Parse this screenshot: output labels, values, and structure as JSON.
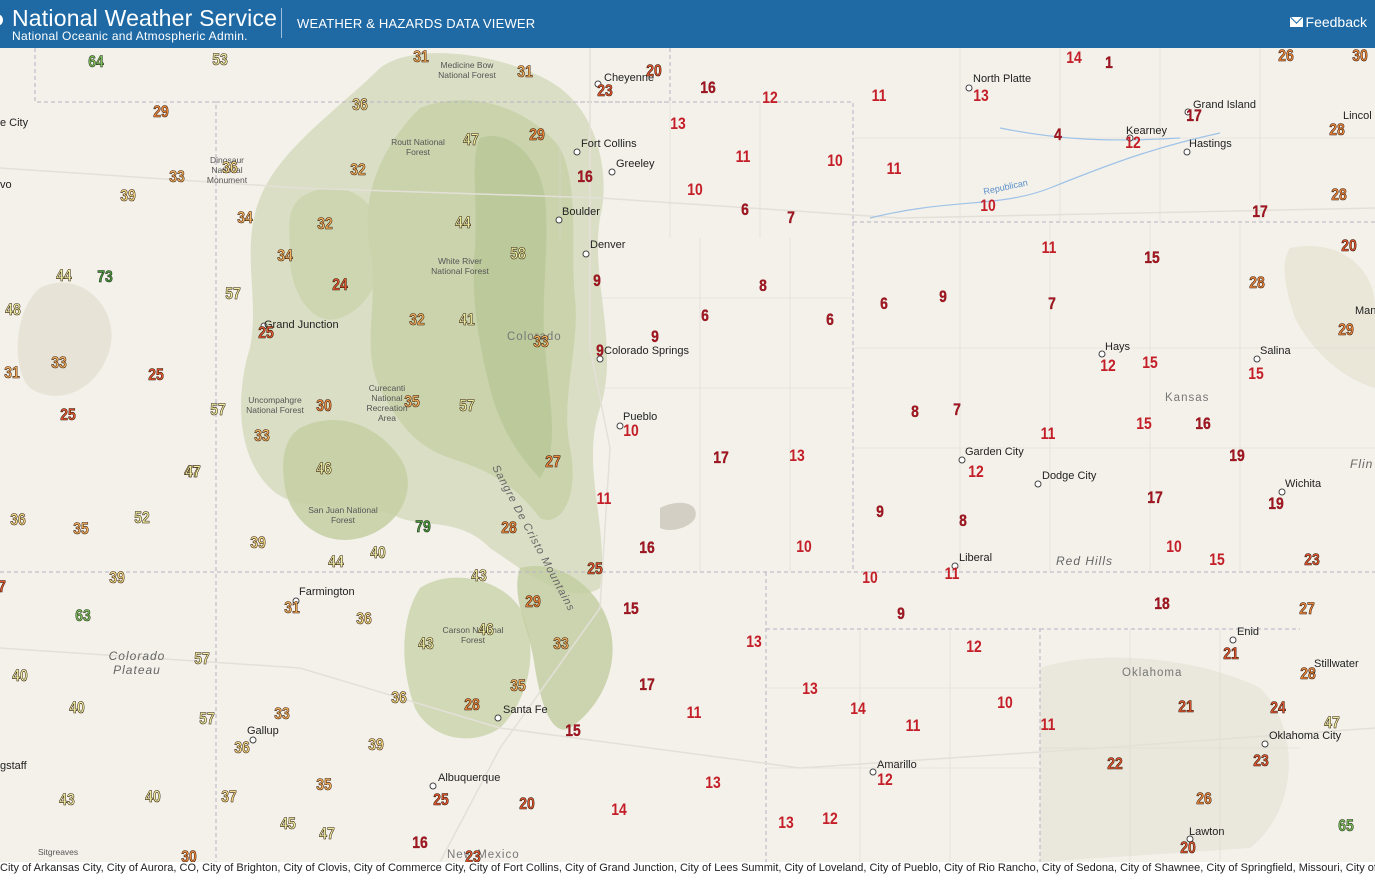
{
  "header": {
    "title": "National Weather Service",
    "subtitle": "National Oceanic and Atmospheric Admin.",
    "viewer_title": "WEATHER & HAZARDS DATA VIEWER",
    "feedback_label": "Feedback"
  },
  "map_labels": {
    "cities": [
      "Cheyenne",
      "North Platte",
      "Grand Island",
      "Kearney",
      "Hastings",
      "Fort Collins",
      "Greeley",
      "Boulder",
      "Denver",
      "Colorado Springs",
      "Pueblo",
      "Garden City",
      "Dodge City",
      "Hays",
      "Salina",
      "Wichita",
      "Liberal",
      "Grand Junction",
      "Farmington",
      "Santa Fe",
      "Gallup",
      "Albuquerque",
      "Amarillo",
      "Enid",
      "Stillwater",
      "Oklahoma City",
      "Lawton",
      "Man",
      "Lincol"
    ],
    "edge_cities": [
      "e City",
      "vo",
      "gstaff"
    ],
    "regions": [
      "Colorado Plateau",
      "Red Hills",
      "Republican",
      "Sangre De Cristo Mountains",
      "Colorado",
      "Kansas",
      "Oklahoma",
      "New Mexico",
      "Flin"
    ],
    "forests": [
      "Medicine Bow National Forest",
      "Routt National Forest",
      "Dinosaur National Monument",
      "White River National Forest",
      "Uncompahgre National Forest",
      "Curecanti National Recreation Area",
      "San Juan National Forest",
      "Carson National Forest",
      "Sitgreaves"
    ]
  },
  "temperatures": [
    {
      "value": "64",
      "cls": "c-green"
    },
    {
      "value": "53",
      "cls": "c-lyellow"
    },
    {
      "value": "31",
      "cls": "c-lorange"
    },
    {
      "value": "31",
      "cls": "c-lorange"
    },
    {
      "value": "20",
      "cls": "c-ored"
    },
    {
      "value": "23",
      "cls": "c-ored"
    },
    {
      "value": "16",
      "cls": "c-dark"
    },
    {
      "value": "12",
      "cls": "c-red"
    },
    {
      "value": "11",
      "cls": "c-red"
    },
    {
      "value": "13",
      "cls": "c-red"
    },
    {
      "value": "14",
      "cls": "c-red"
    },
    {
      "value": "1",
      "cls": "c-dark"
    },
    {
      "value": "26",
      "cls": "c-orange"
    },
    {
      "value": "30",
      "cls": "c-orange"
    },
    {
      "value": "29",
      "cls": "c-orange"
    },
    {
      "value": "36",
      "cls": "c-yellow"
    },
    {
      "value": "47",
      "cls": "c-lyellow"
    },
    {
      "value": "29",
      "cls": "c-orange"
    },
    {
      "value": "13",
      "cls": "c-red"
    },
    {
      "value": "17",
      "cls": "c-dark"
    },
    {
      "value": "28",
      "cls": "c-orange"
    },
    {
      "value": "33",
      "cls": "c-lorange"
    },
    {
      "value": "36",
      "cls": "c-yellow"
    },
    {
      "value": "32",
      "cls": "c-lorange"
    },
    {
      "value": "16",
      "cls": "c-dark"
    },
    {
      "value": "11",
      "cls": "c-red"
    },
    {
      "value": "10",
      "cls": "c-red"
    },
    {
      "value": "11",
      "cls": "c-red"
    },
    {
      "value": "4",
      "cls": "c-dark"
    },
    {
      "value": "12",
      "cls": "c-red"
    },
    {
      "value": "39",
      "cls": "c-yellow"
    },
    {
      "value": "10",
      "cls": "c-red"
    },
    {
      "value": "10",
      "cls": "c-red"
    },
    {
      "value": "28",
      "cls": "c-orange"
    },
    {
      "value": "34",
      "cls": "c-lorange"
    },
    {
      "value": "32",
      "cls": "c-lorange"
    },
    {
      "value": "44",
      "cls": "c-lyellow"
    },
    {
      "value": "6",
      "cls": "c-dark"
    },
    {
      "value": "7",
      "cls": "c-dark"
    },
    {
      "value": "17",
      "cls": "c-dark"
    },
    {
      "value": "58",
      "cls": "c-lyellow"
    },
    {
      "value": "11",
      "cls": "c-red"
    },
    {
      "value": "15",
      "cls": "c-dark"
    },
    {
      "value": "20",
      "cls": "c-ored"
    },
    {
      "value": "44",
      "cls": "c-lyellow"
    },
    {
      "value": "73",
      "cls": "c-dgreen"
    },
    {
      "value": "34",
      "cls": "c-lorange"
    },
    {
      "value": "9",
      "cls": "c-dark"
    },
    {
      "value": "8",
      "cls": "c-dark"
    },
    {
      "value": "28",
      "cls": "c-orange"
    },
    {
      "value": "24",
      "cls": "c-ored"
    },
    {
      "value": "57",
      "cls": "c-lyellow"
    },
    {
      "value": "48",
      "cls": "c-lyellow"
    },
    {
      "value": "6",
      "cls": "c-dark"
    },
    {
      "value": "6",
      "cls": "c-dark"
    },
    {
      "value": "6",
      "cls": "c-dark"
    },
    {
      "value": "9",
      "cls": "c-dark"
    },
    {
      "value": "7",
      "cls": "c-dark"
    },
    {
      "value": "32",
      "cls": "c-lorange"
    },
    {
      "value": "41",
      "cls": "c-lyellow"
    },
    {
      "value": "25",
      "cls": "c-ored"
    },
    {
      "value": "9",
      "cls": "c-dark"
    },
    {
      "value": "29",
      "cls": "c-orange"
    },
    {
      "value": "33",
      "cls": "c-lorange"
    },
    {
      "value": "9",
      "cls": "c-dark"
    },
    {
      "value": "33",
      "cls": "c-lorange"
    },
    {
      "value": "12",
      "cls": "c-red"
    },
    {
      "value": "15",
      "cls": "c-red"
    },
    {
      "value": "15",
      "cls": "c-red"
    },
    {
      "value": "31",
      "cls": "c-lorange"
    },
    {
      "value": "25",
      "cls": "c-ored"
    },
    {
      "value": "25",
      "cls": "c-ored"
    },
    {
      "value": "57",
      "cls": "c-lyellow"
    },
    {
      "value": "30",
      "cls": "c-orange"
    },
    {
      "value": "35",
      "cls": "c-lorange"
    },
    {
      "value": "57",
      "cls": "c-lyellow"
    },
    {
      "value": "10",
      "cls": "c-red"
    },
    {
      "value": "8",
      "cls": "c-dark"
    },
    {
      "value": "7",
      "cls": "c-dark"
    },
    {
      "value": "15",
      "cls": "c-red"
    },
    {
      "value": "16",
      "cls": "c-dark"
    },
    {
      "value": "33",
      "cls": "c-lorange"
    },
    {
      "value": "11",
      "cls": "c-red"
    },
    {
      "value": "47",
      "cls": "c-lyellow"
    },
    {
      "value": "46",
      "cls": "c-lyellow"
    },
    {
      "value": "27",
      "cls": "c-orange"
    },
    {
      "value": "17",
      "cls": "c-dark"
    },
    {
      "value": "13",
      "cls": "c-red"
    },
    {
      "value": "12",
      "cls": "c-red"
    },
    {
      "value": "19",
      "cls": "c-dark"
    },
    {
      "value": "11",
      "cls": "c-red"
    },
    {
      "value": "17",
      "cls": "c-dark"
    },
    {
      "value": "19",
      "cls": "c-dark"
    },
    {
      "value": "36",
      "cls": "c-yellow"
    },
    {
      "value": "35",
      "cls": "c-lorange"
    },
    {
      "value": "52",
      "cls": "c-lyellow"
    },
    {
      "value": "79",
      "cls": "c-dgreen"
    },
    {
      "value": "28",
      "cls": "c-orange"
    },
    {
      "value": "9",
      "cls": "c-dark"
    },
    {
      "value": "8",
      "cls": "c-dark"
    },
    {
      "value": "39",
      "cls": "c-yellow"
    },
    {
      "value": "40",
      "cls": "c-lyellow"
    },
    {
      "value": "16",
      "cls": "c-dark"
    },
    {
      "value": "10",
      "cls": "c-red"
    },
    {
      "value": "10",
      "cls": "c-red"
    },
    {
      "value": "15",
      "cls": "c-red"
    },
    {
      "value": "44",
      "cls": "c-lyellow"
    },
    {
      "value": "25",
      "cls": "c-ored"
    },
    {
      "value": "23",
      "cls": "c-ored"
    },
    {
      "value": "7",
      "cls": "c-ored"
    },
    {
      "value": "39",
      "cls": "c-yellow"
    },
    {
      "value": "43",
      "cls": "c-lyellow"
    },
    {
      "value": "10",
      "cls": "c-red"
    },
    {
      "value": "11",
      "cls": "c-red"
    },
    {
      "value": "29",
      "cls": "c-orange"
    },
    {
      "value": "31",
      "cls": "c-lorange"
    },
    {
      "value": "15",
      "cls": "c-dark"
    },
    {
      "value": "18",
      "cls": "c-dark"
    },
    {
      "value": "27",
      "cls": "c-orange"
    },
    {
      "value": "63",
      "cls": "c-green"
    },
    {
      "value": "36",
      "cls": "c-yellow"
    },
    {
      "value": "9",
      "cls": "c-dark"
    },
    {
      "value": "46",
      "cls": "c-lyellow"
    },
    {
      "value": "43",
      "cls": "c-lyellow"
    },
    {
      "value": "33",
      "cls": "c-lorange"
    },
    {
      "value": "13",
      "cls": "c-red"
    },
    {
      "value": "12",
      "cls": "c-red"
    },
    {
      "value": "57",
      "cls": "c-lyellow"
    },
    {
      "value": "21",
      "cls": "c-ored"
    },
    {
      "value": "40",
      "cls": "c-lyellow"
    },
    {
      "value": "28",
      "cls": "c-orange"
    },
    {
      "value": "17",
      "cls": "c-dark"
    },
    {
      "value": "35",
      "cls": "c-lorange"
    },
    {
      "value": "13",
      "cls": "c-red"
    },
    {
      "value": "36",
      "cls": "c-yellow"
    },
    {
      "value": "40",
      "cls": "c-lyellow"
    },
    {
      "value": "28",
      "cls": "c-orange"
    },
    {
      "value": "11",
      "cls": "c-red"
    },
    {
      "value": "14",
      "cls": "c-red"
    },
    {
      "value": "10",
      "cls": "c-red"
    },
    {
      "value": "21",
      "cls": "c-ored"
    },
    {
      "value": "24",
      "cls": "c-ored"
    },
    {
      "value": "57",
      "cls": "c-lyellow"
    },
    {
      "value": "33",
      "cls": "c-lorange"
    },
    {
      "value": "15",
      "cls": "c-dark"
    },
    {
      "value": "11",
      "cls": "c-red"
    },
    {
      "value": "11",
      "cls": "c-red"
    },
    {
      "value": "47",
      "cls": "c-lyellow"
    },
    {
      "value": "36",
      "cls": "c-yellow"
    },
    {
      "value": "39",
      "cls": "c-yellow"
    },
    {
      "value": "22",
      "cls": "c-ored"
    },
    {
      "value": "23",
      "cls": "c-ored"
    },
    {
      "value": "47",
      "cls": "c-lyellow"
    },
    {
      "value": "35",
      "cls": "c-lorange"
    },
    {
      "value": "12",
      "cls": "c-red"
    },
    {
      "value": "13",
      "cls": "c-red"
    },
    {
      "value": "43",
      "cls": "c-lyellow"
    },
    {
      "value": "40",
      "cls": "c-lyellow"
    },
    {
      "value": "37",
      "cls": "c-yellow"
    },
    {
      "value": "25",
      "cls": "c-ored"
    },
    {
      "value": "20",
      "cls": "c-ored"
    },
    {
      "value": "14",
      "cls": "c-red"
    },
    {
      "value": "26",
      "cls": "c-orange"
    },
    {
      "value": "45",
      "cls": "c-lyellow"
    },
    {
      "value": "47",
      "cls": "c-lyellow"
    },
    {
      "value": "13",
      "cls": "c-red"
    },
    {
      "value": "12",
      "cls": "c-red"
    },
    {
      "value": "65",
      "cls": "c-green"
    },
    {
      "value": "16",
      "cls": "c-dark"
    },
    {
      "value": "20",
      "cls": "c-ored"
    },
    {
      "value": "30",
      "cls": "c-orange"
    },
    {
      "value": "23",
      "cls": "c-ored"
    }
  ],
  "footer": {
    "credits": "City of Arkansas City, City of Aurora, CO, City of Brighton, City of Clovis, City of Commerce City, City of Fort Collins, City of Grand Junction, City of Lees Summit, City of Loveland, City of Pueblo, City of Rio Rancho, City of Sedona, City of Shawnee, City of Springfield, Missouri, City of"
  }
}
